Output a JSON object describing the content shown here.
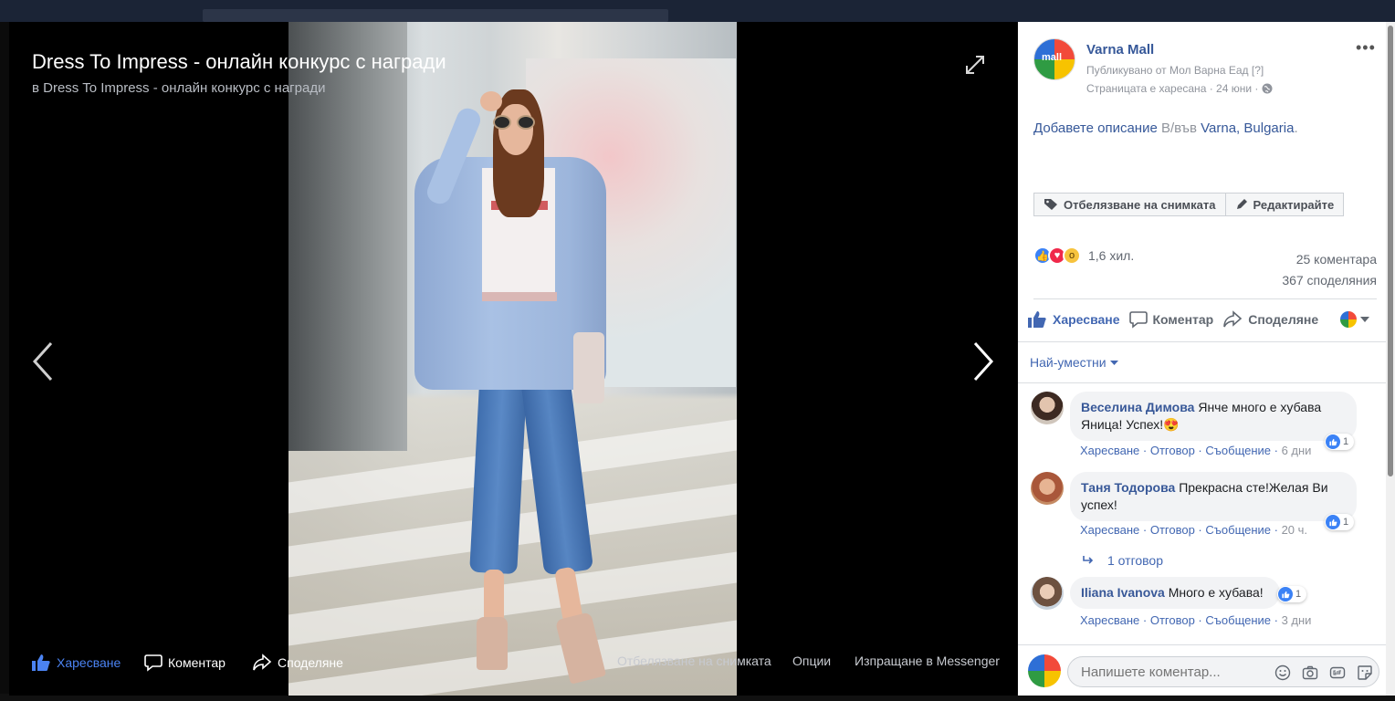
{
  "viewer": {
    "title": "Dress To Impress - онлайн конкурс с награди",
    "subtitle": "в Dress To Impress - онлайн конкурс с награди",
    "bottom": {
      "like": "Харесване",
      "comment": "Коментар",
      "share": "Споделяне",
      "tag": "Отбелязване на снимката",
      "options": "Опции",
      "messenger": "Изпращане в Messenger"
    }
  },
  "post": {
    "page_name": "Varna Mall",
    "avatar_text": "mall",
    "published_by": "Публикувано от Мол Варна Еад",
    "published_hint": "[?]",
    "liked_line": "Страницата е харесана · 24 юни ·",
    "description": {
      "link": "Добавете описание",
      "sep": " В/във ",
      "place": "Varna, Bulgaria",
      "dot": "."
    },
    "tag_button": "Отбелязване на снимката",
    "edit_button": "Редактирайте",
    "reactions_count": "1,6 хил.",
    "comments_count": "25 коментара",
    "shares_count": "367 споделяния",
    "actions": {
      "like": "Харесване",
      "comment": "Коментар",
      "share": "Споделяне"
    },
    "sort_label": "Най-уместни"
  },
  "comments": [
    {
      "name": "Веселина Димова",
      "text_line1": "Янче много е хубава",
      "text_line2": "Яница! Успех!😍",
      "react_count": "1",
      "like": "Харесване",
      "reply": "Отговор",
      "message": "Съобщение",
      "time": "6 дни"
    },
    {
      "name": "Таня Тодорова",
      "text_line1": "Прекрасна сте!Желая Ви",
      "text_line2": "успех!",
      "react_count": "1",
      "like": "Харесване",
      "reply": "Отговор",
      "message": "Съобщение",
      "time": "20 ч."
    },
    {
      "name": "Iliana Ivanova",
      "text_line1": "Много е хубава!",
      "react_count": "1",
      "like": "Харесване",
      "reply": "Отговор",
      "message": "Съобщение",
      "time": "3 дни"
    }
  ],
  "replies_link": "1 отговор",
  "compose": {
    "placeholder": "Напишете коментар..."
  },
  "colors": {
    "link": "#365899",
    "accent": "#4267b2",
    "muted": "#90949c"
  }
}
